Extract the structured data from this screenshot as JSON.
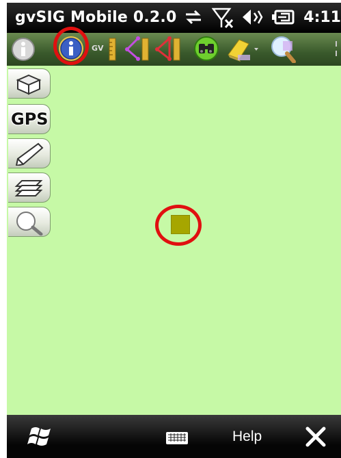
{
  "statusbar": {
    "app_title": "gvSIG Mobile 0.2.0",
    "time": "4:11",
    "icons": [
      "connectivity-icon",
      "signal-off-icon",
      "volume-icon",
      "battery-icon"
    ]
  },
  "toolbar": {
    "tools": [
      {
        "name": "info-tool-grey",
        "icon": "info-icon"
      },
      {
        "name": "info-tool-active",
        "icon": "info-icon",
        "highlighted": true
      },
      {
        "name": "gps-line-tool",
        "icon": "gps-ruler-icon"
      },
      {
        "name": "measure-distance-tool",
        "icon": "distance-ruler-icon"
      },
      {
        "name": "measure-area-tool",
        "icon": "area-ruler-icon"
      },
      {
        "name": "find-tool",
        "icon": "binoculars-icon"
      },
      {
        "name": "eraser-tool",
        "icon": "eraser-icon"
      },
      {
        "name": "zoom-tool",
        "icon": "zoom-icon"
      }
    ]
  },
  "sidebar": {
    "items": [
      {
        "name": "layers-3d",
        "icon": "cube-icon"
      },
      {
        "name": "gps",
        "label": "GPS"
      },
      {
        "name": "edit",
        "icon": "pencil-icon"
      },
      {
        "name": "layers",
        "icon": "layers-icon"
      },
      {
        "name": "search",
        "icon": "magnifier-icon"
      }
    ]
  },
  "map": {
    "background_color": "#c6f9a6",
    "point_color": "#a6a600",
    "highlight_color": "#e01010"
  },
  "bottombar": {
    "help_label": "Help",
    "icons": [
      "windows-start-icon",
      "keyboard-icon",
      "close-icon"
    ]
  }
}
